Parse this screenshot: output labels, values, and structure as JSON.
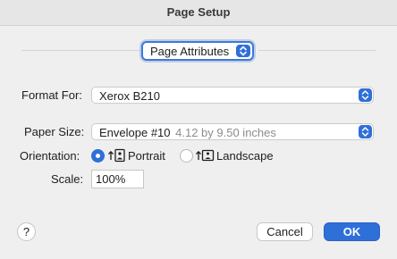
{
  "window": {
    "title": "Page Setup"
  },
  "mode_popup": {
    "value": "Page Attributes"
  },
  "format_for": {
    "label": "Format For:",
    "value": "Xerox B210"
  },
  "paper_size": {
    "label": "Paper Size:",
    "value": "Envelope #10",
    "detail": "4.12 by 9.50 inches"
  },
  "orientation": {
    "label": "Orientation:",
    "options": [
      {
        "label": "Portrait",
        "selected": true,
        "icon": "portrait-icon"
      },
      {
        "label": "Landscape",
        "selected": false,
        "icon": "landscape-icon"
      }
    ]
  },
  "scale": {
    "label": "Scale:",
    "value": "100%"
  },
  "footer": {
    "help_label": "?",
    "cancel_label": "Cancel",
    "ok_label": "OK"
  },
  "colors": {
    "accent": "#2f6fd8",
    "background": "#efefef"
  }
}
